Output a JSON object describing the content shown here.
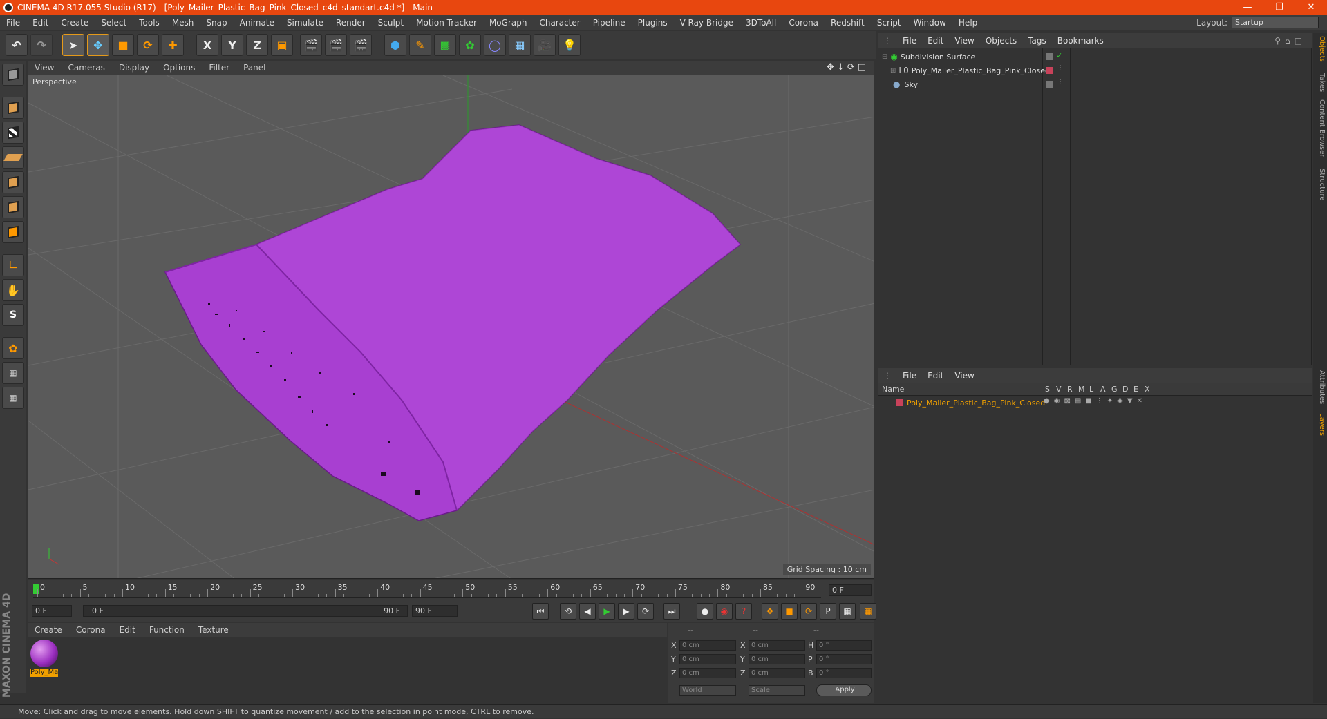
{
  "window": {
    "title": "CINEMA 4D R17.055 Studio (R17) - [Poly_Mailer_Plastic_Bag_Pink_Closed_c4d_standart.c4d *] - Main"
  },
  "menubar": {
    "items": [
      "File",
      "Edit",
      "Create",
      "Select",
      "Tools",
      "Mesh",
      "Snap",
      "Animate",
      "Simulate",
      "Render",
      "Sculpt",
      "Motion Tracker",
      "MoGraph",
      "Character",
      "Pipeline",
      "Plugins",
      "V-Ray Bridge",
      "3DToAll",
      "Corona",
      "Redshift",
      "Script",
      "Window",
      "Help"
    ],
    "layout_label": "Layout:",
    "layout_value": "Startup"
  },
  "toolbar": {
    "axis_x": "X",
    "axis_y": "Y",
    "axis_z": "Z"
  },
  "viewport": {
    "menu": [
      "View",
      "Cameras",
      "Display",
      "Options",
      "Filter",
      "Panel"
    ],
    "label": "Perspective",
    "grid_spacing": "Grid Spacing : 10 cm"
  },
  "timeline": {
    "ticks": [
      "0",
      "5",
      "10",
      "15",
      "20",
      "25",
      "30",
      "35",
      "40",
      "45",
      "50",
      "55",
      "60",
      "65",
      "70",
      "75",
      "80",
      "85",
      "90"
    ],
    "current_frame": "0 F"
  },
  "transport": {
    "start": "0 F",
    "range_start": "0 F",
    "range_end": "90 F",
    "end": "90 F"
  },
  "material_manager": {
    "menu": [
      "Create",
      "Corona",
      "Edit",
      "Function",
      "Texture"
    ],
    "material_name": "Poly_Ma"
  },
  "coordinates": {
    "header": [
      "--",
      "--",
      "--"
    ],
    "rows": [
      {
        "a": "X",
        "av": "0 cm",
        "b": "X",
        "bv": "0 cm",
        "c": "H",
        "cv": "0 °"
      },
      {
        "a": "Y",
        "av": "0 cm",
        "b": "Y",
        "bv": "0 cm",
        "c": "P",
        "cv": "0 °"
      },
      {
        "a": "Z",
        "av": "0 cm",
        "b": "Z",
        "bv": "0 cm",
        "c": "B",
        "cv": "0 °"
      }
    ],
    "mode1": "World",
    "mode2": "Scale",
    "apply": "Apply"
  },
  "branding": {
    "logo": "MAXON CINEMA 4D"
  },
  "statusbar": {
    "text": "Move: Click and drag to move elements. Hold down SHIFT to quantize movement / add to the selection in point mode, CTRL to remove."
  },
  "object_manager": {
    "menu": [
      "File",
      "Edit",
      "View",
      "Objects",
      "Tags",
      "Bookmarks"
    ],
    "objects": [
      {
        "name": "Subdivision Surface"
      },
      {
        "name": "Poly_Mailer_Plastic_Bag_Pink_Closed"
      },
      {
        "name": "Sky"
      }
    ]
  },
  "layer_manager": {
    "menu": [
      "File",
      "Edit",
      "View"
    ],
    "columns": [
      "Name",
      "S",
      "V",
      "R",
      "M",
      "L",
      "A",
      "G",
      "D",
      "E",
      "X"
    ],
    "layers": [
      {
        "name": "Poly_Mailer_Plastic_Bag_Pink_Closed"
      }
    ]
  },
  "right_tabs": [
    "Objects",
    "Takes",
    "Content Browser",
    "Structure",
    "Attributes",
    "Layers"
  ],
  "colors": {
    "titlebar": "#e8470f",
    "bag": "#a83fd1",
    "layer_name": "#f0a000"
  }
}
